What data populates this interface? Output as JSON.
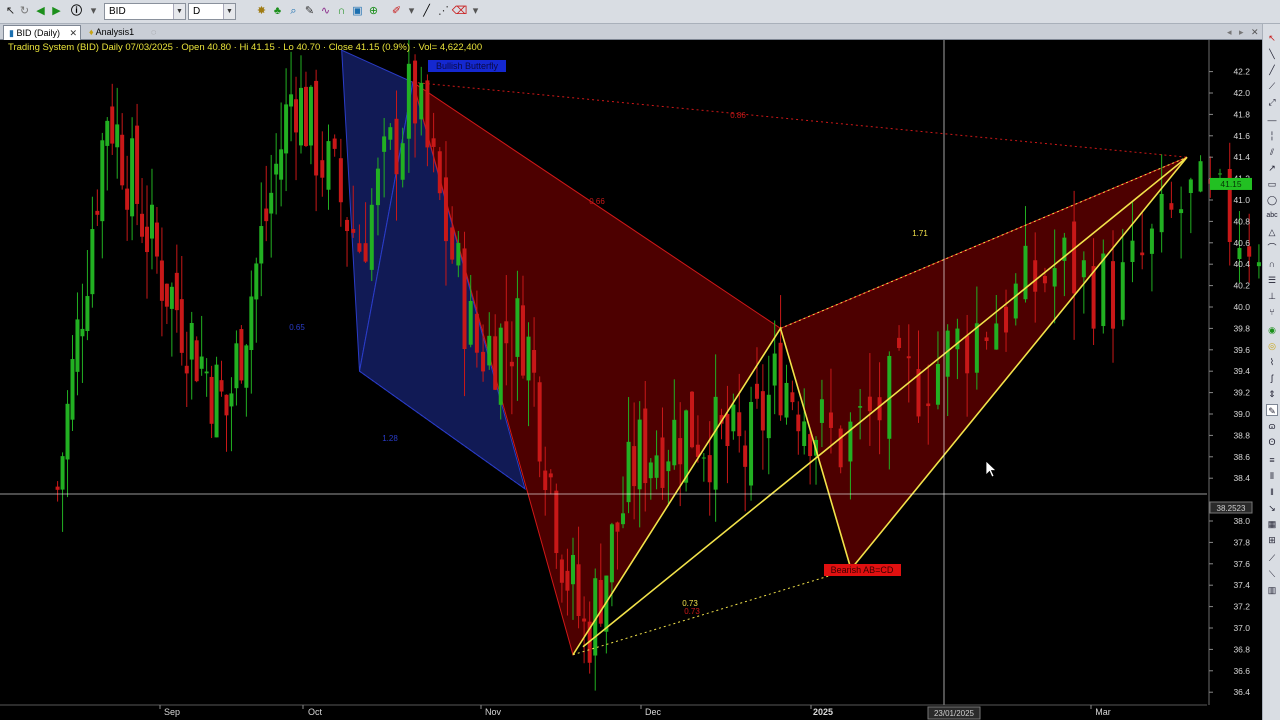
{
  "toolbar": {
    "symbol": "BID",
    "interval": "D"
  },
  "tabs": [
    {
      "label": "BID (Daily)"
    },
    {
      "label": "Analysis1"
    }
  ],
  "info_line": "Trading System (BID) Daily 07/03/2025 · Open 40.80 · Hi 41.15 · Lo 40.70 · Close 41.15 (0.9%) · Vol= 4,622,400",
  "price_axis_labels": [
    "42.2",
    "42.0",
    "41.8",
    "41.6",
    "41.4",
    "41.2",
    "41.0",
    "40.8",
    "40.6",
    "40.4",
    "40.2",
    "40.0",
    "39.8",
    "39.6",
    "39.4",
    "39.2",
    "39.0",
    "38.8",
    "38.6",
    "38.4",
    "38.0",
    "37.8",
    "37.6",
    "37.4",
    "37.2",
    "37.0",
    "36.8",
    "36.6",
    "36.4"
  ],
  "last_price_badge": "41.15",
  "crosshair_price_badge": "38.2523",
  "crosshair_date_badge": "23/01/2025",
  "time_axis_labels": [
    "Sep",
    "Oct",
    "Nov",
    "Dec",
    "2025",
    "Mar"
  ],
  "patterns": {
    "bullish_label": "Bullish Butterfly",
    "bearish_label": "Bearish AB=CD",
    "ratio_labels": [
      "0.86",
      "0.66",
      "0.65",
      "1.28",
      "1.71",
      "0.73",
      "0.73"
    ]
  },
  "colors": {
    "up_candle": "#22b022",
    "down_candle": "#c81818",
    "bullish_fill": "#141e64",
    "bearish_fill": "#5a0000",
    "pattern_line": "#f2e24a",
    "crosshair": "#ffffff",
    "info_text": "#e8e23a"
  },
  "chart_data": {
    "type": "candlestick",
    "symbol": "BID",
    "interval": "Daily",
    "ylim": [
      36.3,
      42.3
    ],
    "months": [
      "Sep",
      "Oct",
      "Nov",
      "Dec",
      "2025",
      "Mar"
    ],
    "ohlc_last": {
      "date": "07/03/2025",
      "open": 40.8,
      "high": 41.15,
      "low": 40.7,
      "close": 41.15,
      "change_pct": 0.9,
      "volume": 4622400
    },
    "close_path_keypoints": [
      {
        "month_pos": -0.8,
        "close": 38.3
      },
      {
        "month_pos": -0.45,
        "close": 41.9
      },
      {
        "month_pos": -0.1,
        "close": 40.4
      },
      {
        "month_pos": 0.38,
        "close": 39.0
      },
      {
        "month_pos": 0.85,
        "close": 42.1
      },
      {
        "month_pos": 1.25,
        "close": 40.6
      },
      {
        "month_pos": 1.55,
        "close": 42.0
      },
      {
        "month_pos": 1.9,
        "close": 39.6
      },
      {
        "month_pos": 2.2,
        "close": 39.8
      },
      {
        "month_pos": 2.45,
        "close": 37.6
      },
      {
        "month_pos": 2.58,
        "close": 36.9
      },
      {
        "month_pos": 2.9,
        "close": 38.6
      },
      {
        "month_pos": 3.2,
        "close": 38.9
      },
      {
        "month_pos": 3.55,
        "close": 38.6
      },
      {
        "month_pos": 3.75,
        "close": 39.4
      },
      {
        "month_pos": 4.05,
        "close": 38.7
      },
      {
        "month_pos": 4.55,
        "close": 39.8
      },
      {
        "month_pos": 4.85,
        "close": 40.4
      },
      {
        "month_pos": 5.05,
        "close": 40.1
      },
      {
        "month_pos": 5.3,
        "close": 41.0
      },
      {
        "month_pos": 5.6,
        "close": 40.6
      },
      {
        "month_pos": 5.8,
        "close": 41.15
      }
    ],
    "bullish_butterfly_points": [
      [
        1.15,
        42.4
      ],
      [
        1.25,
        39.4
      ],
      [
        1.55,
        42.1
      ],
      [
        2.2,
        38.3
      ]
    ],
    "bearish_abcd_points": [
      [
        1.55,
        42.1
      ],
      [
        2.5,
        36.75
      ],
      [
        3.75,
        39.8
      ],
      [
        4.1,
        37.55
      ],
      [
        5.3,
        41.4
      ]
    ],
    "crosshair": {
      "price": 38.2523,
      "date": "23/01/2025"
    }
  }
}
